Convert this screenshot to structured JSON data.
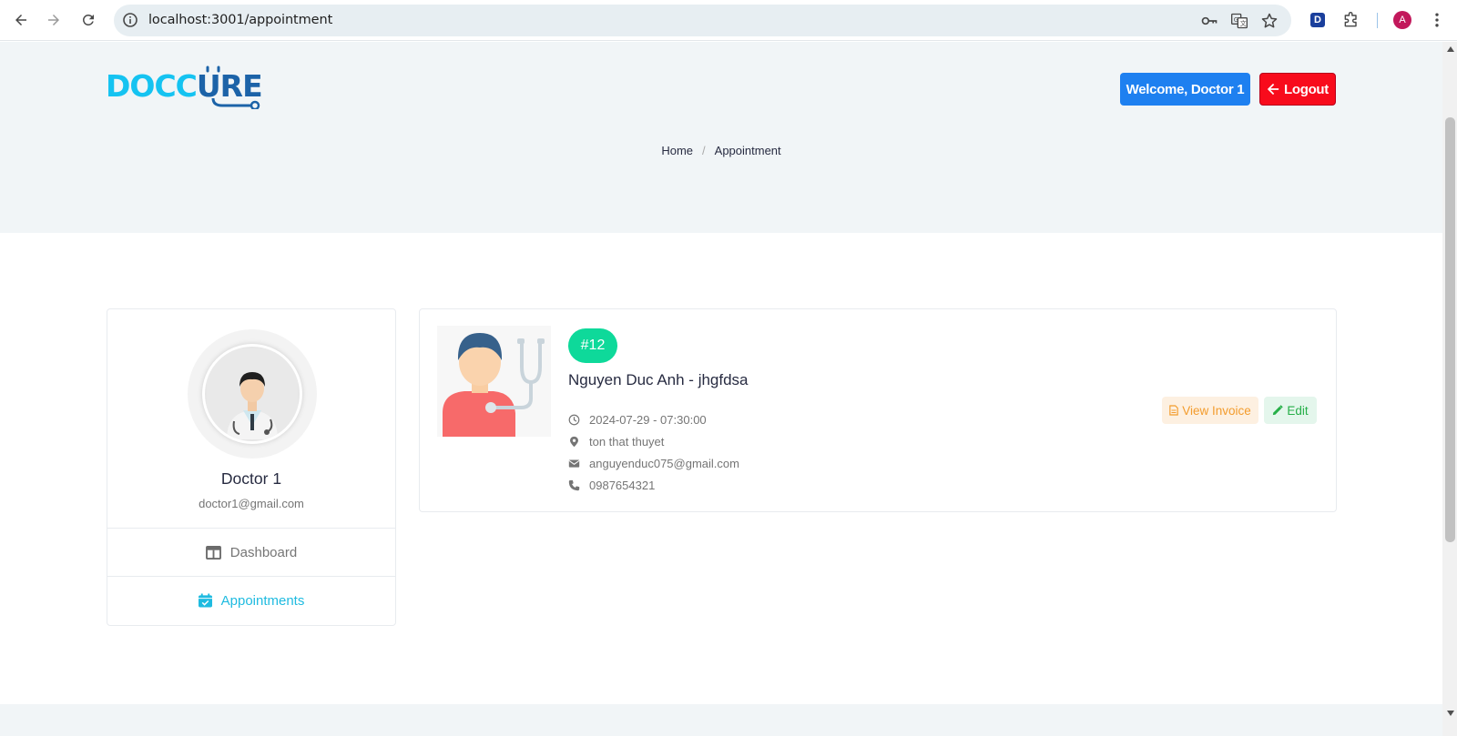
{
  "browser": {
    "url": "localhost:3001/appointment",
    "profile_initial": "A",
    "extension_letter": "D"
  },
  "header": {
    "logo_part1": "DOCC",
    "logo_part2": "URE",
    "logo_u": "U",
    "welcome_label": "Welcome, Doctor 1",
    "logout_label": "Logout"
  },
  "breadcrumb": {
    "home": "Home",
    "separator": "/",
    "current": "Appointment"
  },
  "profile": {
    "name": "Doctor 1",
    "email": "doctor1@gmail.com"
  },
  "sidebar": {
    "items": [
      {
        "label": "Dashboard",
        "icon": "columns-icon",
        "active": false
      },
      {
        "label": "Appointments",
        "icon": "calendar-check-icon",
        "active": true
      }
    ]
  },
  "appointment": {
    "id_badge": "#12",
    "title": "Nguyen Duc Anh - jhgfdsa",
    "datetime": "2024-07-29 - 07:30:00",
    "address": "ton that thuyet",
    "email": "anguyenduc075@gmail.com",
    "phone": "0987654321",
    "view_invoice_label": "View Invoice",
    "edit_label": "Edit"
  },
  "colors": {
    "brand_cyan": "#15c3f1",
    "brand_blue": "#1c63a8",
    "welcome_blue": "#1e80f0",
    "logout_red": "#f80b1c",
    "badge_green": "#0ed99a",
    "active_link": "#1fbbe0"
  }
}
